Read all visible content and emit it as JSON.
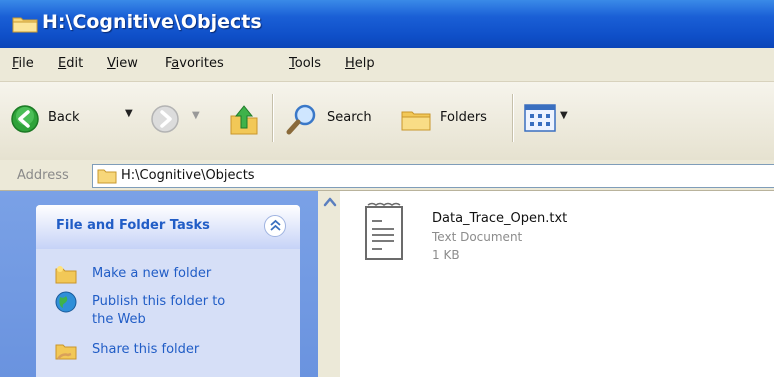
{
  "window": {
    "title": "H:\\Cognitive\\Objects",
    "title_icon": "folder-icon"
  },
  "menu": [
    {
      "first": "F",
      "rest": "ile"
    },
    {
      "first": "E",
      "rest": "dit"
    },
    {
      "first": "V",
      "rest": "iew"
    },
    {
      "first": "",
      "pre": "F",
      "u": "a",
      "post": "vorites"
    },
    {
      "first": "T",
      "rest": "ools"
    },
    {
      "first": "H",
      "rest": "elp"
    }
  ],
  "toolbar": {
    "back_label": "Back",
    "search_label": "Search",
    "folders_label": "Folders",
    "icons": {
      "back": "back-arrow-icon",
      "forward": "forward-arrow-icon",
      "up": "up-folder-icon",
      "search": "magnifier-icon",
      "folders": "folders-icon",
      "views": "views-icon"
    }
  },
  "address": {
    "label": "Address",
    "value": "H:\\Cognitive\\Objects"
  },
  "task_pane": {
    "title": "File and Folder Tasks",
    "tasks": [
      {
        "label": "Make a new folder",
        "icon": "new-folder-icon"
      },
      {
        "label_line1": "Publish this folder to",
        "label_line2": "the Web",
        "icon": "globe-icon"
      },
      {
        "label": "Share this folder",
        "icon": "share-folder-icon"
      }
    ]
  },
  "files": [
    {
      "name": "Data_Trace_Open.txt",
      "type": "Text Document",
      "size": "1 KB",
      "icon": "text-document-icon"
    }
  ],
  "colors": {
    "titlebar": "#0f4fc8",
    "task_link": "#215dc6",
    "pane_bg": "#6a93df"
  }
}
